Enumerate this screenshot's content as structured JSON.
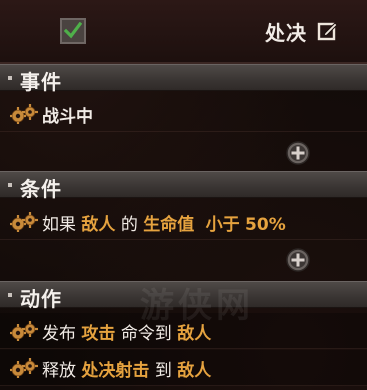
{
  "header": {
    "checkbox_checked": true,
    "title": "处决",
    "edit_icon": "edit-icon",
    "accent_check": "#4fb04a"
  },
  "sections": {
    "events": {
      "label": "事件",
      "rows": [
        {
          "parts": [
            "战斗中"
          ]
        }
      ]
    },
    "conditions": {
      "label": "条件",
      "rows": [
        {
          "parts": [
            "如果",
            "敌人",
            "的",
            "生命值",
            "小于",
            "50%"
          ]
        }
      ]
    },
    "actions": {
      "label": "动作",
      "rows": [
        {
          "parts": [
            "发布",
            "攻击",
            "命令到",
            "敌人"
          ]
        },
        {
          "parts": [
            "释放",
            "处决射击",
            "到",
            "敌人"
          ]
        }
      ]
    }
  },
  "icons": {
    "row_icon": "gears-icon",
    "add_icon": "add-circle-icon"
  },
  "colors": {
    "keyword": "#e6a33f",
    "text": "#f1ebe6",
    "section_bar": "#3a3533"
  },
  "watermark": "游侠网"
}
